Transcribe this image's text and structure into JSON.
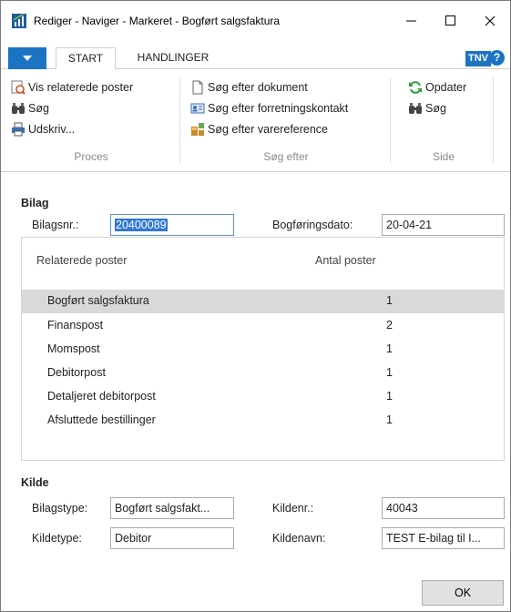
{
  "window": {
    "title": "Rediger - Naviger - Markeret - Bogført salgsfaktura"
  },
  "ribbon": {
    "tabs": [
      {
        "label": "START"
      },
      {
        "label": "HANDLINGER"
      }
    ],
    "user_badge": "TNV",
    "help_label": "?",
    "groups": [
      {
        "label": "Proces",
        "items": [
          {
            "label": "Vis relaterede poster",
            "icon": "show-related-icon"
          },
          {
            "label": "Søg",
            "icon": "binoculars-icon"
          },
          {
            "label": "Udskriv...",
            "icon": "printer-icon"
          }
        ]
      },
      {
        "label": "Søg efter",
        "items": [
          {
            "label": "Søg efter dokument",
            "icon": "document-icon"
          },
          {
            "label": "Søg efter forretningskontakt",
            "icon": "contact-card-icon"
          },
          {
            "label": "Søg efter varereference",
            "icon": "item-reference-icon"
          }
        ]
      },
      {
        "label": "Side",
        "items": [
          {
            "label": "Opdater",
            "icon": "refresh-icon"
          },
          {
            "label": "Søg",
            "icon": "binoculars-icon"
          }
        ]
      }
    ]
  },
  "bilag": {
    "title": "Bilag",
    "bilagsnr_label": "Bilagsnr.:",
    "bilagsnr_value": "20400089",
    "bogforingsdato_label": "Bogføringsdato:",
    "bogforingsdato_value": "20-04-21"
  },
  "grid": {
    "columns": [
      "Relaterede poster",
      "Antal poster"
    ],
    "rows": [
      {
        "name": "Bogført salgsfaktura",
        "count": "1"
      },
      {
        "name": "Finanspost",
        "count": "2"
      },
      {
        "name": "Momspost",
        "count": "1"
      },
      {
        "name": "Debitorpost",
        "count": "1"
      },
      {
        "name": "Detaljeret debitorpost",
        "count": "1"
      },
      {
        "name": "Afsluttede bestillinger",
        "count": "1"
      }
    ]
  },
  "kilde": {
    "title": "Kilde",
    "bilagstype_label": "Bilagstype:",
    "bilagstype_value": "Bogført salgsfakt...",
    "kildenr_label": "Kildenr.:",
    "kildenr_value": "40043",
    "kildetype_label": "Kildetype:",
    "kildetype_value": "Debitor",
    "kildenavn_label": "Kildenavn:",
    "kildenavn_value": "TEST E-bilag til I..."
  },
  "footer": {
    "ok_label": "OK"
  },
  "colors": {
    "accent": "#1b73c2",
    "selection": "#3178d6",
    "row_selected": "#d9d9d9"
  }
}
